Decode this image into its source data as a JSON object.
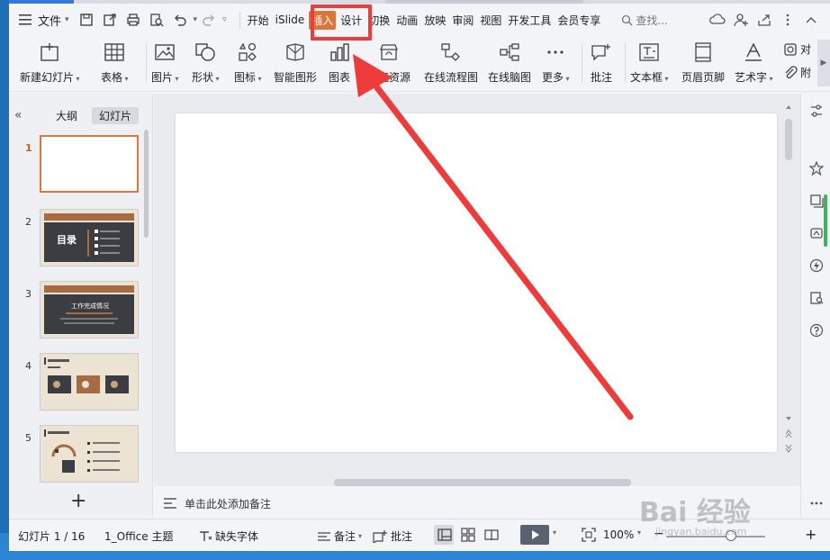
{
  "menu": {
    "file_label": "文件",
    "tabs": [
      "开始",
      "iSlide",
      "插入",
      "设计",
      "切换",
      "动画",
      "放映",
      "审阅",
      "视图",
      "开发工具",
      "会员专享"
    ],
    "active_tab": "插入",
    "search_placeholder": "查找..."
  },
  "ribbon": {
    "new_slide": "新建幻灯片",
    "table": "表格",
    "picture": "图片",
    "shape": "形状",
    "icon": "图标",
    "smart_art": "智能图形",
    "chart": "图表",
    "resources": "稻壳资源",
    "flowchart": "在线流程图",
    "mindmap": "在线脑图",
    "more": "更多",
    "comment": "批注",
    "textbox": "文本框",
    "header_footer": "页眉页脚",
    "wordart": "艺术字",
    "object": "对",
    "attachment": "附"
  },
  "left_panel": {
    "tab_outline": "大纲",
    "tab_slides": "幻灯片",
    "thumbnails": [
      "1",
      "2",
      "3",
      "4",
      "5"
    ],
    "thumb2_title": "目录",
    "thumb3_title": "工作完成情况"
  },
  "notes": {
    "placeholder": "单击此处添加备注"
  },
  "status": {
    "slide_counter": "幻灯片 1 / 16",
    "theme": "1_Office 主题",
    "missing_fonts": "缺失字体",
    "notes": "备注",
    "comments": "批注",
    "zoom": "100%"
  },
  "watermark": {
    "text": "Bai 经验",
    "url": "jingyan.baidu.com"
  },
  "colors": {
    "accent": "#d9773f",
    "annotation": "#ee3b3b",
    "thumb_dark": "#3b3d42",
    "thumb_header": "#a86a45",
    "thumb_beige": "#ede3d3"
  }
}
